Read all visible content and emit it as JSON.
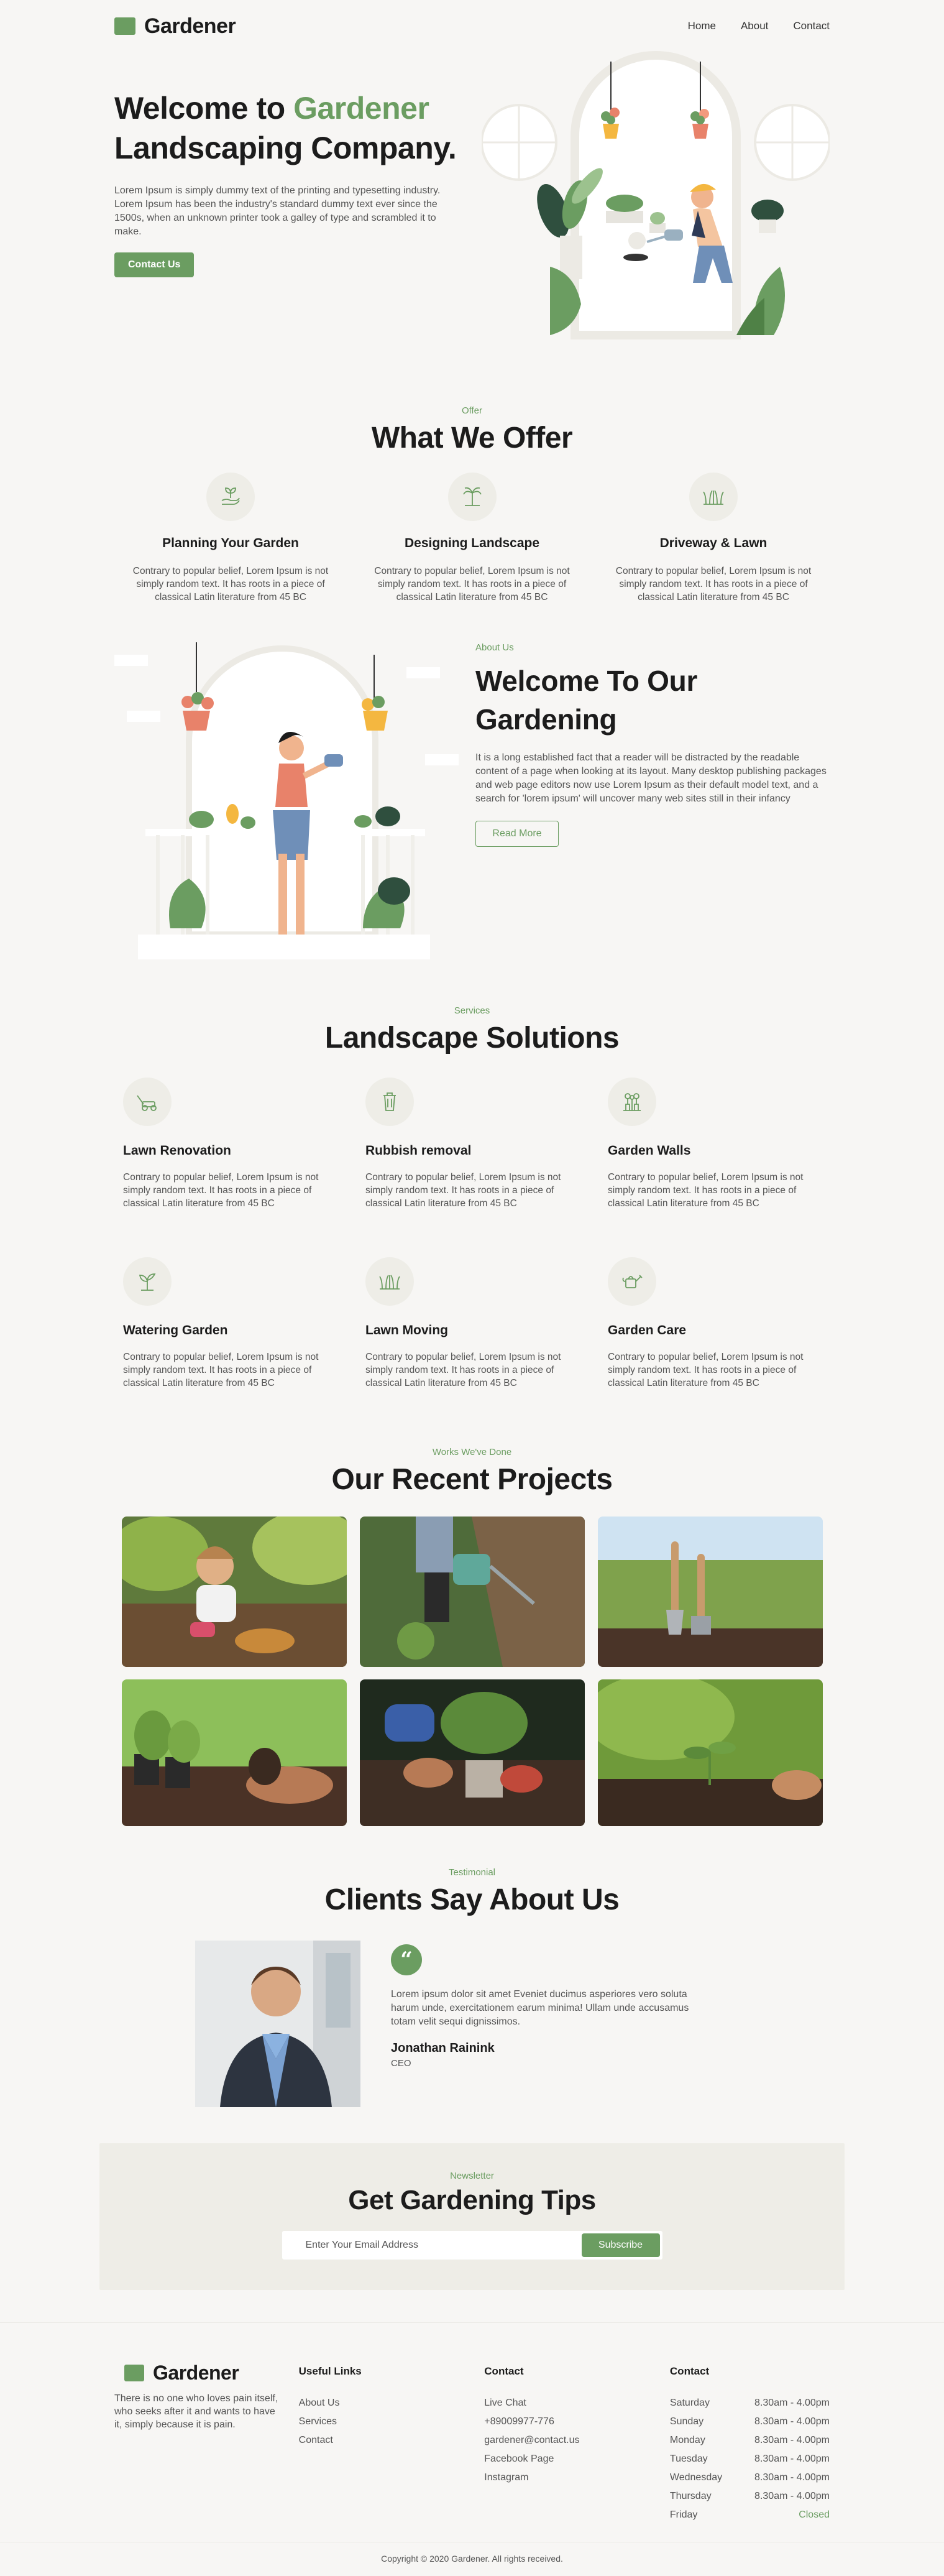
{
  "brand": {
    "name": "Gardener",
    "accent_color": "#6b9d61"
  },
  "nav": {
    "items": [
      "Home",
      "About",
      "Contact"
    ]
  },
  "hero": {
    "title_prefix": "Welcome to ",
    "title_accent": "Gardener",
    "title_line2": "Landscaping Company.",
    "description": "Lorem Ipsum is simply dummy text of the printing and typesetting industry. Lorem Ipsum has been the industry's standard dummy text ever since the 1500s, when an unknown printer took a galley of type and scrambled it to make.",
    "cta": "Contact Us"
  },
  "offer": {
    "eyebrow": "Offer",
    "title": "What We Offer",
    "items": [
      {
        "icon": "hand-plant-icon",
        "title": "Planning Your Garden",
        "text": "Contrary to popular belief, Lorem Ipsum is not simply random text. It has roots in a piece of classical Latin literature from 45 BC"
      },
      {
        "icon": "palm-tree-icon",
        "title": "Designing Landscape",
        "text": "Contrary to popular belief, Lorem Ipsum is not simply random text. It has roots in a piece of classical Latin literature from 45 BC"
      },
      {
        "icon": "grass-icon",
        "title": "Driveway & Lawn",
        "text": "Contrary to popular belief, Lorem Ipsum is not simply random text. It has roots in a piece of classical Latin literature from 45 BC"
      }
    ]
  },
  "about": {
    "eyebrow": "About Us",
    "title": "Welcome To Our Gardening",
    "description": "It is a long established fact that a reader will be distracted by the readable content of a page when looking at its layout. Many desktop publishing packages and web page editors now use Lorem Ipsum as their default model text, and a search for 'lorem ipsum' will uncover many web sites still in their infancy",
    "cta": "Read More"
  },
  "services": {
    "eyebrow": "Services",
    "title": "Landscape Solutions",
    "items": [
      {
        "icon": "lawn-mower-icon",
        "title": "Lawn Renovation",
        "text": "Contrary to popular belief, Lorem Ipsum is not simply random text. It has roots in a piece of classical Latin literature from 45 BC"
      },
      {
        "icon": "trash-bin-icon",
        "title": "Rubbish removal",
        "text": "Contrary to popular belief, Lorem Ipsum is not simply random text. It has roots in a piece of classical Latin literature from 45 BC"
      },
      {
        "icon": "plant-wall-icon",
        "title": "Garden Walls",
        "text": "Contrary to popular belief, Lorem Ipsum is not simply random text. It has roots in a piece of classical Latin literature from 45 BC"
      },
      {
        "icon": "sprout-icon",
        "title": "Watering Garden",
        "text": "Contrary to popular belief, Lorem Ipsum is not simply random text. It has roots in a piece of classical Latin literature from 45 BC"
      },
      {
        "icon": "grass-icon",
        "title": "Lawn Moving",
        "text": "Contrary to popular belief, Lorem Ipsum is not simply random text. It has roots in a piece of classical Latin literature from 45 BC"
      },
      {
        "icon": "watering-can-icon",
        "title": "Garden Care",
        "text": "Contrary to popular belief, Lorem Ipsum is not simply random text. It has roots in a piece of classical Latin literature from 45 BC"
      }
    ]
  },
  "projects": {
    "eyebrow": "Works We've Done",
    "title": "Our Recent Projects",
    "photos": [
      "child-planting-photo",
      "watering-can-photo",
      "garden-tools-photo",
      "seedling-pots-photo",
      "transplanting-photo",
      "sprout-soil-photo"
    ]
  },
  "testimonial": {
    "eyebrow": "Testimonial",
    "title": "Clients Say About Us",
    "quote_mark": "“",
    "quote": "Lorem ipsum dolor sit amet Eveniet ducimus asperiores vero soluta harum unde, exercitationem earum minima! Ullam unde accusamus totam velit sequi dignissimos.",
    "name": "Jonathan Rainink",
    "role": "CEO"
  },
  "newsletter": {
    "eyebrow": "Newsletter",
    "title": "Get Gardening Tips",
    "placeholder": "Enter Your Email Address",
    "button": "Subscribe"
  },
  "footer": {
    "about": "There is no one who loves pain itself, who seeks after it and wants to have it, simply because it is pain.",
    "links_title": "Useful Links",
    "links": [
      "About Us",
      "Services",
      "Contact"
    ],
    "contact_title": "Contact",
    "contact": [
      "Live Chat",
      "+89009977-776",
      "gardener@contact.us",
      "Facebook Page",
      "Instagram"
    ],
    "hours_title": "Contact",
    "hours": [
      {
        "day": "Saturday",
        "time": "8.30am - 4.00pm"
      },
      {
        "day": "Sunday",
        "time": "8.30am - 4.00pm"
      },
      {
        "day": "Monday",
        "time": "8.30am - 4.00pm"
      },
      {
        "day": "Tuesday",
        "time": "8.30am - 4.00pm"
      },
      {
        "day": "Wednesday",
        "time": "8.30am - 4.00pm"
      },
      {
        "day": "Thursday",
        "time": "8.30am - 4.00pm"
      },
      {
        "day": "Friday",
        "time": "Closed"
      }
    ],
    "copyright": "Copyright © 2020 Gardener. All rights received."
  }
}
